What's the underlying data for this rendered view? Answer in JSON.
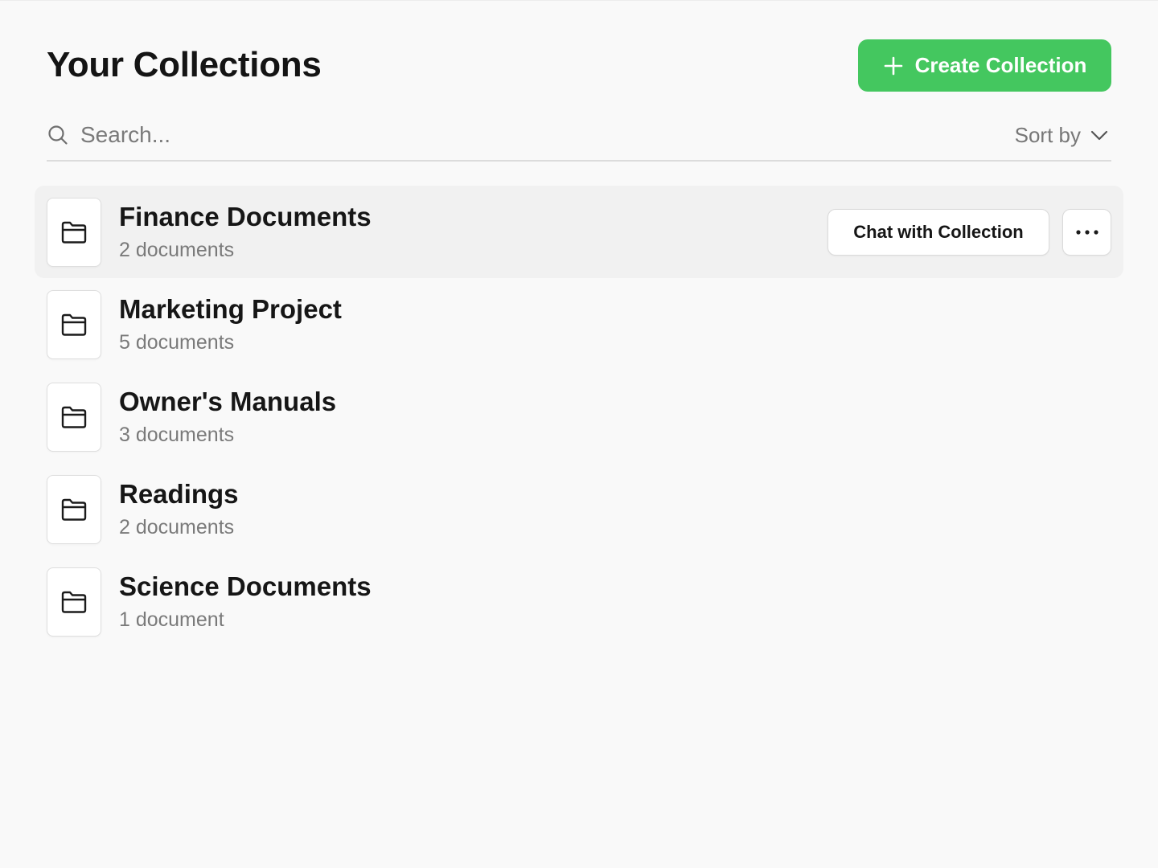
{
  "header": {
    "title": "Your Collections",
    "create_button_label": "Create Collection",
    "create_icon": "plus-icon"
  },
  "search": {
    "placeholder": "Search...",
    "value": "",
    "icon": "search-icon"
  },
  "sort": {
    "label": "Sort by",
    "icon": "chevron-down-icon"
  },
  "collections": [
    {
      "name": "Finance Documents",
      "count": "2 documents",
      "hovered": true
    },
    {
      "name": "Marketing Project",
      "count": "5 documents",
      "hovered": false
    },
    {
      "name": "Owner's Manuals",
      "count": "3 documents",
      "hovered": false
    },
    {
      "name": "Readings",
      "count": "2 documents",
      "hovered": false
    },
    {
      "name": "Science Documents",
      "count": "1 document",
      "hovered": false
    }
  ],
  "row_actions": {
    "chat_label": "Chat with Collection",
    "more_icon": "more-icon"
  },
  "colors": {
    "accent": "#44c75f",
    "background": "#f9f9f9",
    "hover_row": "#f1f1f1",
    "muted_text": "#7a7a7a"
  }
}
